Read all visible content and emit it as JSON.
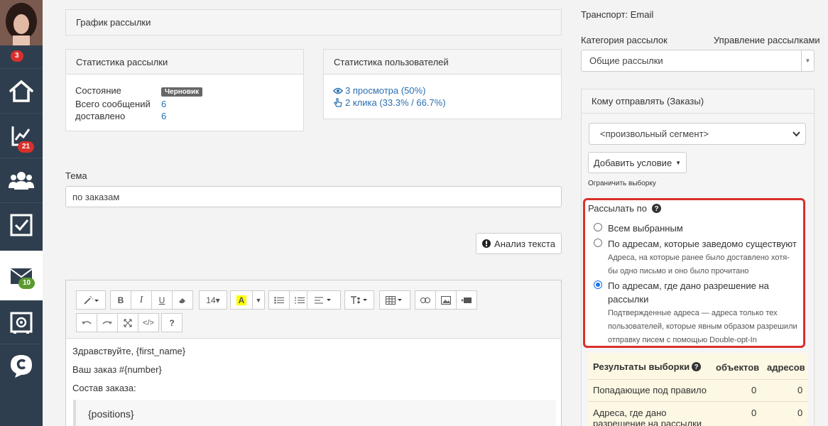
{
  "sidebar": {
    "badge_avatar": "3",
    "badge_stats": "21",
    "badge_mail": "10"
  },
  "schedule_panel": {
    "title": "График рассылки"
  },
  "mail_stats": {
    "title": "Статистика рассылки",
    "state_label": "Состояние",
    "state_value": "Черновик",
    "total_label": "Всего сообщений",
    "total_value": "6",
    "delivered_label": "доставлено",
    "delivered_value": "6"
  },
  "user_stats": {
    "title": "Статистика пользователей",
    "views": "3 просмотра (50%)",
    "clicks": "2 клика (33.3% / 66.7%)"
  },
  "subject": {
    "label": "Тема",
    "value": "по заказам"
  },
  "analyze_button": "Анализ текста",
  "editor": {
    "font_size": "14",
    "line1": "Здравствуйте, {first_name}",
    "line2": "Ваш заказ #{number}",
    "line3": "Состав заказа:",
    "quote": "{positions}"
  },
  "right": {
    "transport": "Транспорт: Email",
    "category_label": "Категория рассылок",
    "manage_link": "Управление рассылками",
    "category_value": "Общие рассылки",
    "recipients_title": "Кому отправлять (Заказы)",
    "segment_value": "<произвольный сегмент>",
    "add_condition": "Добавить условие",
    "limit_link": "Ограничить выборку",
    "send_by_label": "Рассылать по",
    "opt1": "Всем выбранным",
    "opt2": "По адресам, которые заведомо существуют",
    "opt2_desc": "Адреса, на которые ранее было доставлено хотя-бы одно письмо и оно было прочитано",
    "opt3": "По адресам, где дано разрешение на рассылки",
    "opt3_desc": "Подтвержденные адреса — адреса только тех пользователей, которые явным образом разрешили отправку писем с помощью Double-opt-In"
  },
  "results": {
    "title": "Результаты выборки",
    "col_objects": "объектов",
    "col_addresses": "адресов",
    "row1_label": "Попадающие под правило",
    "row1_objects": "0",
    "row1_addresses": "0",
    "row2_label": "Адреса, где дано разрешение на рассылки",
    "row2_objects": "0",
    "row2_addresses": "0"
  },
  "colors": {
    "accent": "#2a6fb0",
    "highlight_border": "#d9302c",
    "sidebar": "#2f3e4e",
    "results_bg": "#fcf8e3"
  }
}
